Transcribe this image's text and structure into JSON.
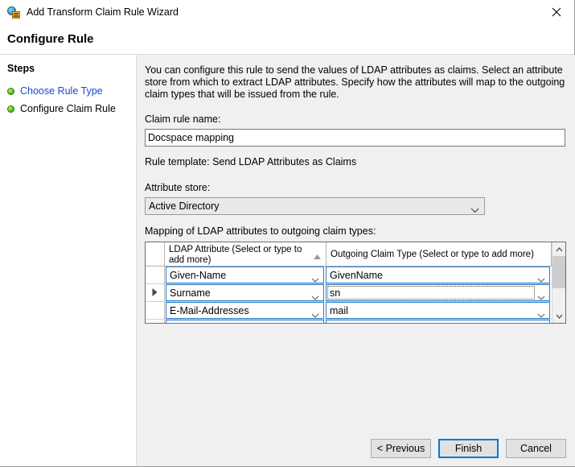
{
  "window": {
    "title": "Add Transform Claim Rule Wizard",
    "icon": "claim-rule-wizard-icon",
    "close_label": "close-icon"
  },
  "header": {
    "title": "Configure Rule"
  },
  "steps": {
    "heading": "Steps",
    "items": [
      {
        "label": "Choose Rule Type",
        "state": "completed-link"
      },
      {
        "label": "Configure Claim Rule",
        "state": "current"
      }
    ]
  },
  "main": {
    "intro": "You can configure this rule to send the values of LDAP attributes as claims. Select an attribute store from which to extract LDAP attributes. Specify how the attributes will map to the outgoing claim types that will be issued from the rule.",
    "claim_rule_name_label": "Claim rule name:",
    "claim_rule_name_value": "Docspace mapping",
    "claim_rule_name_placeholder": "",
    "rule_template": "Rule template: Send LDAP Attributes as Claims",
    "attribute_store_label": "Attribute store:",
    "attribute_store_value": "Active Directory",
    "mapping_label": "Mapping of LDAP attributes to outgoing claim types:"
  },
  "grid": {
    "columns": [
      {
        "key": "rowsel",
        "label": ""
      },
      {
        "key": "ldap",
        "label": "LDAP Attribute (Select or type to add more)",
        "sort": "ascending"
      },
      {
        "key": "claim",
        "label": "Outgoing Claim Type (Select or type to add more)"
      }
    ],
    "rows": [
      {
        "current": false,
        "ldap": "Given-Name",
        "claim": "GivenName",
        "focused": false
      },
      {
        "current": true,
        "ldap": "Surname",
        "claim": "sn",
        "focused": true
      },
      {
        "current": false,
        "ldap": "E-Mail-Addresses",
        "claim": "mail",
        "focused": false
      }
    ]
  },
  "footer": {
    "previous_label": "< Previous",
    "finish_label": "Finish",
    "cancel_label": "Cancel"
  },
  "colors": {
    "accent": "#0078d7",
    "link": "#1a49d1",
    "step_bullet": "#62c127",
    "cell_border": "#2a7fd0",
    "content_bg": "#f0f0f0"
  }
}
